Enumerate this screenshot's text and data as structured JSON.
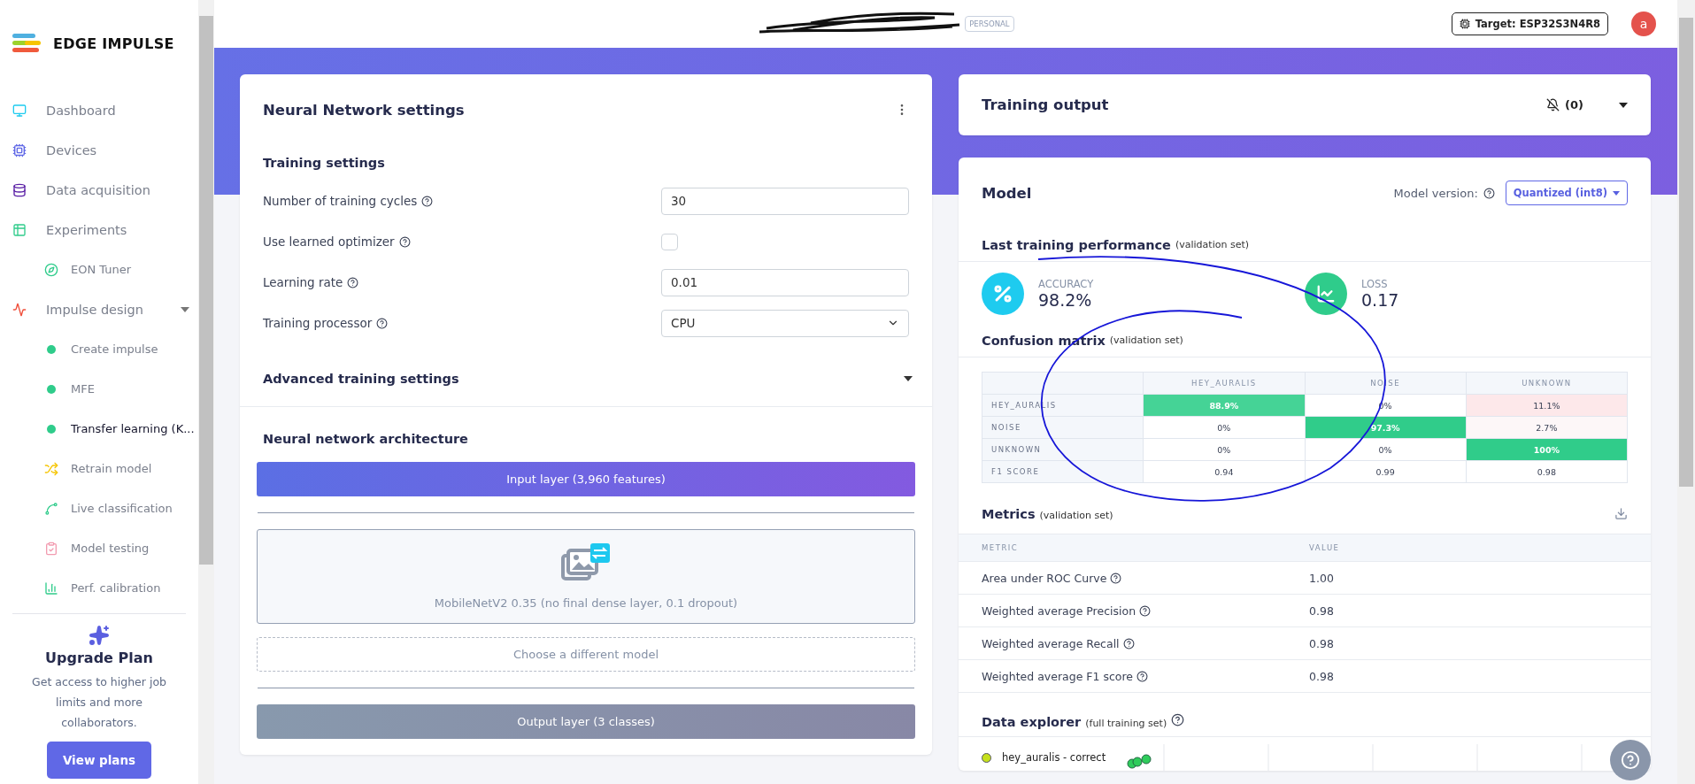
{
  "brand": "EDGE IMPULSE",
  "sidebar": {
    "items": [
      {
        "label": "Dashboard",
        "kind": "section",
        "selected": false
      },
      {
        "label": "Devices",
        "kind": "section",
        "selected": false
      },
      {
        "label": "Data acquisition",
        "kind": "section",
        "selected": false
      },
      {
        "label": "Experiments",
        "kind": "section",
        "selected": false
      },
      {
        "label": "EON Tuner",
        "kind": "sub",
        "selected": false
      },
      {
        "label": "Impulse design",
        "kind": "section",
        "selected": false,
        "expanded": true
      },
      {
        "label": "Create impulse",
        "kind": "step",
        "selected": false
      },
      {
        "label": "MFE",
        "kind": "step",
        "selected": false
      },
      {
        "label": "Transfer learning (K...",
        "kind": "step",
        "selected": true
      },
      {
        "label": "Retrain model",
        "kind": "sub",
        "selected": false
      },
      {
        "label": "Live classification",
        "kind": "sub",
        "selected": false
      },
      {
        "label": "Model testing",
        "kind": "sub",
        "selected": false
      },
      {
        "label": "Perf. calibration",
        "kind": "sub",
        "selected": false
      }
    ],
    "upgrade": {
      "title": "Upgrade Plan",
      "text": "Get access to higher job limits and more collaborators.",
      "button": "View plans"
    }
  },
  "header": {
    "badge": "PERSONAL",
    "target": "Target: ESP32S3N4R8",
    "avatar": "a"
  },
  "nn_settings": {
    "title": "Neural Network settings",
    "section": "Training settings",
    "fields": [
      {
        "label": "Number of training cycles",
        "kind": "number",
        "value": "30"
      },
      {
        "label": "Use learned optimizer",
        "kind": "checkbox",
        "checked": false
      },
      {
        "label": "Learning rate",
        "kind": "number",
        "value": "0.01"
      },
      {
        "label": "Training processor",
        "kind": "select",
        "value": "CPU"
      }
    ],
    "advanced": {
      "label": "Advanced training settings",
      "expanded": false
    },
    "architecture": {
      "title": "Neural network architecture",
      "input": "Input layer (3,960 features)",
      "model": "MobileNetV2 0.35 (no final dense layer, 0.1 dropout)",
      "choose": "Choose a different model",
      "output": "Output layer (3 classes)"
    }
  },
  "training_output": {
    "title": "Training output",
    "count": "(0)",
    "expanded": false
  },
  "model": {
    "title": "Model",
    "version_label": "Model version:",
    "version": "Quantized (int8)",
    "performance": {
      "title": "Last training performance",
      "note": "(validation set)",
      "stats": [
        {
          "label": "ACCURACY",
          "value": "98.2%",
          "kind": "percent",
          "color": "#1ecbef"
        },
        {
          "label": "LOSS",
          "value": "0.17",
          "kind": "chart",
          "color": "#2fcc8b"
        }
      ]
    },
    "matrix": {
      "title": "Confusion matrix",
      "note": "(validation set)",
      "columns": [
        "HEY_AURALIS",
        "NOISE",
        "UNKNOWN"
      ],
      "rows": [
        {
          "label": "HEY_AURALIS",
          "cells": [
            {
              "text": "88.9%",
              "color": "#45d396"
            },
            {
              "text": "0%",
              "color": "#ffffff"
            },
            {
              "text": "11.1%",
              "color": "#fde8ea"
            }
          ]
        },
        {
          "label": "NOISE",
          "cells": [
            {
              "text": "0%",
              "color": "#ffffff"
            },
            {
              "text": "97.3%",
              "color": "#30cc8a"
            },
            {
              "text": "2.7%",
              "color": "#fdf7f8"
            }
          ]
        },
        {
          "label": "UNKNOWN",
          "cells": [
            {
              "text": "0%",
              "color": "#ffffff"
            },
            {
              "text": "0%",
              "color": "#ffffff"
            },
            {
              "text": "100%",
              "color": "#30cc8a"
            }
          ]
        },
        {
          "label": "F1 SCORE",
          "cells": [
            {
              "text": "0.94",
              "color": "#ffffff"
            },
            {
              "text": "0.99",
              "color": "#ffffff"
            },
            {
              "text": "0.98",
              "color": "#ffffff"
            }
          ]
        }
      ]
    },
    "metrics": {
      "title": "Metrics",
      "note": "(validation set)",
      "columns": [
        "METRIC",
        "VALUE"
      ],
      "rows": [
        [
          "Area under ROC Curve",
          "1.00"
        ],
        [
          "Weighted average Precision",
          "0.98"
        ],
        [
          "Weighted average Recall",
          "0.98"
        ],
        [
          "Weighted average F1 score",
          "0.98"
        ]
      ]
    },
    "explorer": {
      "title": "Data explorer",
      "note": "(full training set)",
      "legend": [
        {
          "label": "hey_auralis - correct",
          "color": "#c5e01c"
        }
      ]
    }
  }
}
